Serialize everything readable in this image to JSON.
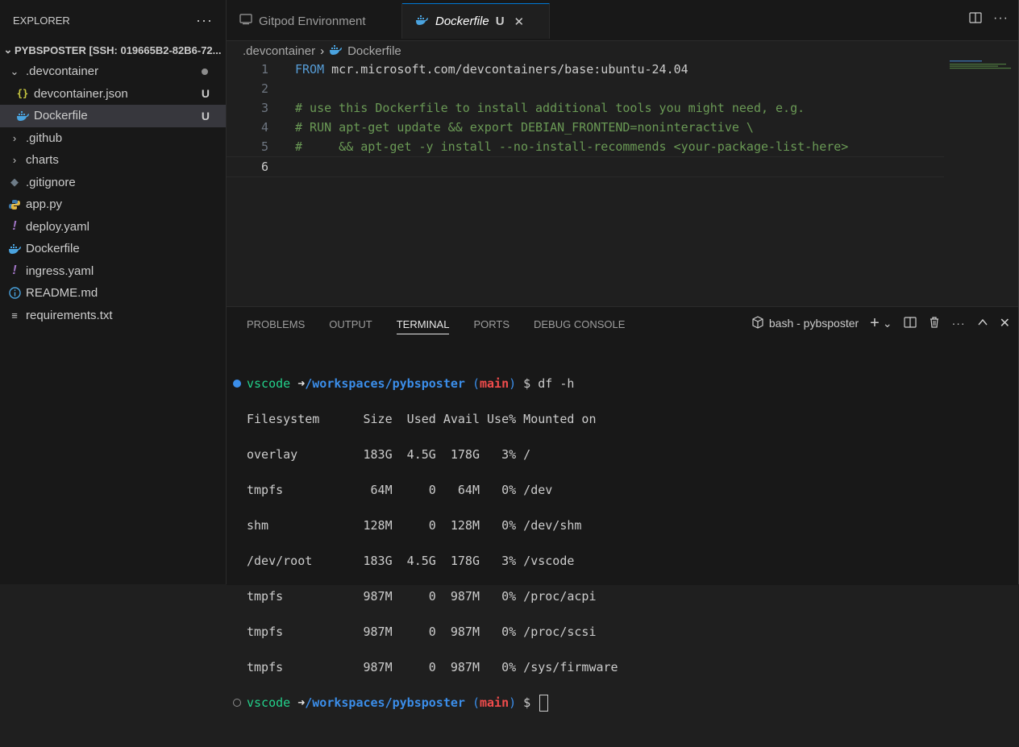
{
  "sidebar": {
    "title": "EXPLORER",
    "more": "···",
    "root": "PYBSPOSTER [SSH: 019665B2-82B6-72...",
    "items": [
      {
        "label": ".devcontainer",
        "badge": ""
      },
      {
        "label": "devcontainer.json",
        "badge": "U"
      },
      {
        "label": "Dockerfile",
        "badge": "U"
      },
      {
        "label": ".github",
        "badge": ""
      },
      {
        "label": "charts",
        "badge": ""
      },
      {
        "label": ".gitignore",
        "badge": ""
      },
      {
        "label": "app.py",
        "badge": ""
      },
      {
        "label": "deploy.yaml",
        "badge": ""
      },
      {
        "label": "Dockerfile",
        "badge": ""
      },
      {
        "label": "ingress.yaml",
        "badge": ""
      },
      {
        "label": "README.md",
        "badge": ""
      },
      {
        "label": "requirements.txt",
        "badge": ""
      }
    ]
  },
  "tabs": [
    {
      "label": "Gitpod Environment"
    },
    {
      "label": "Dockerfile",
      "badge": "U",
      "close": "✕"
    }
  ],
  "breadcrumb": {
    "folder": ".devcontainer",
    "file": "Dockerfile"
  },
  "editor": {
    "lines": [
      {
        "num": "1",
        "kw": "FROM",
        "text": " mcr.microsoft.com/devcontainers/base:ubuntu-24.04"
      },
      {
        "num": "2",
        "text": ""
      },
      {
        "num": "3",
        "comment": "# use this Dockerfile to install additional tools you might need, e.g."
      },
      {
        "num": "4",
        "comment": "# RUN apt-get update && export DEBIAN_FRONTEND=noninteractive \\"
      },
      {
        "num": "5",
        "comment": "#     && apt-get -y install --no-install-recommends <your-package-list-here>"
      },
      {
        "num": "6",
        "text": ""
      }
    ]
  },
  "panel": {
    "tabs": [
      "PROBLEMS",
      "OUTPUT",
      "TERMINAL",
      "PORTS",
      "DEBUG CONSOLE"
    ],
    "active_tab": "TERMINAL",
    "terminal_name": "bash - pybsposter"
  },
  "terminal": {
    "user": "vscode",
    "arrow": " ➜",
    "path": "/workspaces/pybsposter",
    "branch_open": " (",
    "branch": "main",
    "branch_close": ")",
    "command": " $ df -h",
    "prompt_end": " $ ",
    "output": [
      "Filesystem      Size  Used Avail Use% Mounted on",
      "overlay         183G  4.5G  178G   3% /",
      "tmpfs            64M     0   64M   0% /dev",
      "shm             128M     0  128M   0% /dev/shm",
      "/dev/root       183G  4.5G  178G   3% /vscode",
      "tmpfs           987M     0  987M   0% /proc/acpi",
      "tmpfs           987M     0  987M   0% /proc/scsi",
      "tmpfs           987M     0  987M   0% /sys/firmware"
    ]
  },
  "colors": {
    "accent": "#0078d4",
    "prompt_ok": "#3b8eea",
    "branch": "#f14c4c",
    "user": "#23d18b"
  }
}
